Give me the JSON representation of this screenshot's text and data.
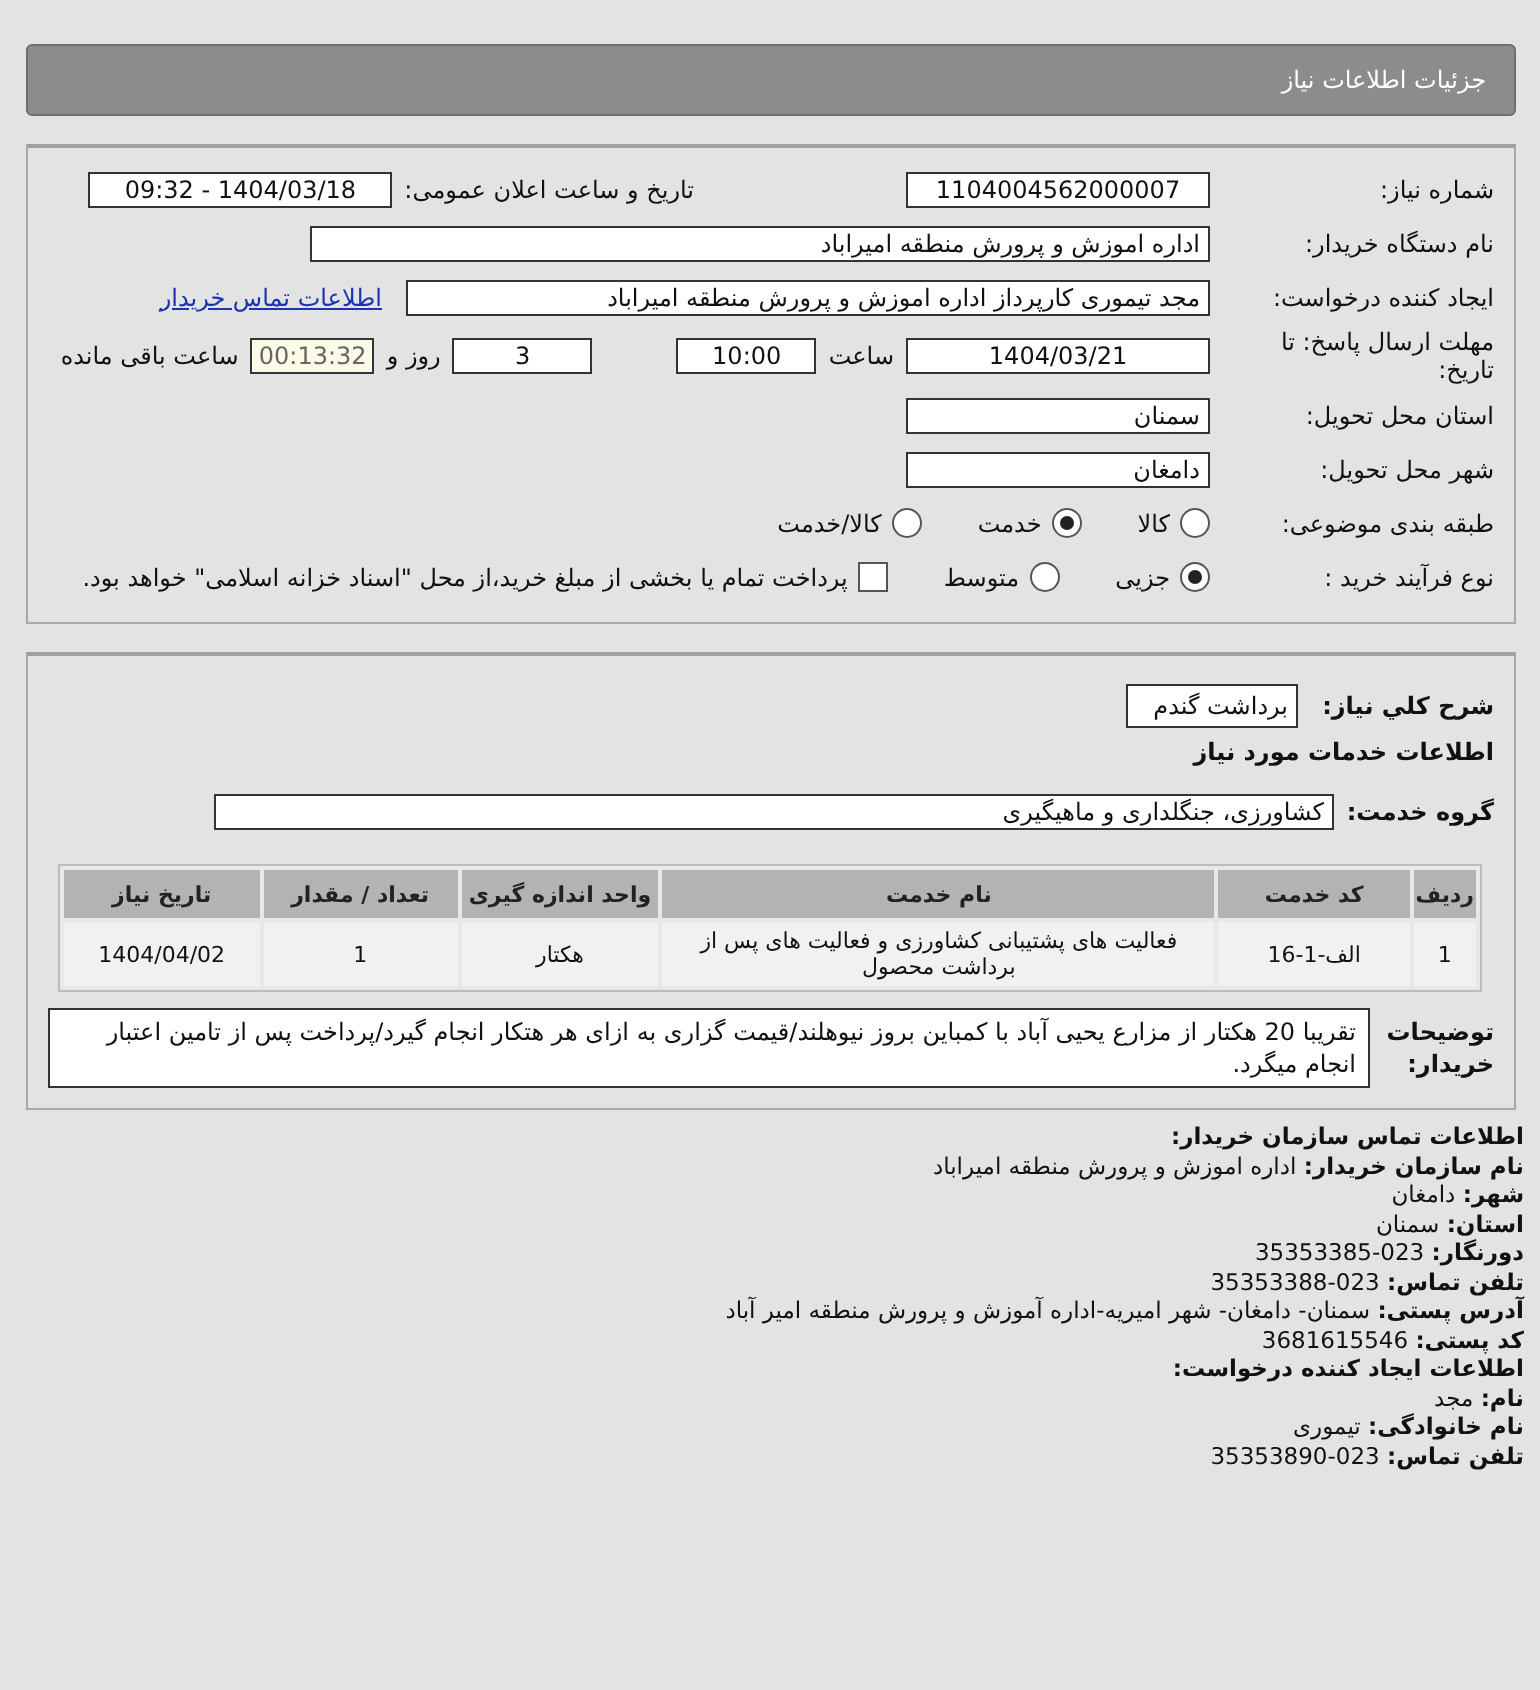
{
  "header": {
    "title": "جزئیات اطلاعات نیاز"
  },
  "details": {
    "need_number": {
      "label": "شماره نیاز:",
      "value": "1104004562000007"
    },
    "announce": {
      "label": "تاریخ و ساعت اعلان عمومی:",
      "value": "1404/03/18 - 09:32"
    },
    "buyer_org": {
      "label": "نام دستگاه خریدار:",
      "value": "اداره اموزش و پرورش منطقه امیراباد"
    },
    "requester": {
      "label": "ایجاد کننده درخواست:",
      "value": "مجد  تیموری کارپرداز اداره اموزش و پرورش منطقه امیراباد",
      "link": "اطلاعات تماس خریدار"
    },
    "deadline": {
      "label": "مهلت ارسال پاسخ: تا تاریخ:",
      "date": "1404/03/21",
      "time_label": "ساعت",
      "time": "10:00",
      "days": "3",
      "days_label": "روز و",
      "remaining": "00:13:32",
      "remaining_label": "ساعت باقی مانده"
    },
    "province": {
      "label": "استان محل تحویل:",
      "value": "سمنان"
    },
    "city": {
      "label": "شهر محل تحویل:",
      "value": "دامغان"
    },
    "category": {
      "label": "طبقه بندی موضوعی:",
      "options": [
        {
          "label": "کالا",
          "selected": false
        },
        {
          "label": "خدمت",
          "selected": true
        },
        {
          "label": "کالا/خدمت",
          "selected": false
        }
      ]
    },
    "process": {
      "label": "نوع فرآیند خرید :",
      "options": [
        {
          "label": "جزیی",
          "selected": true
        },
        {
          "label": "متوسط",
          "selected": false
        }
      ],
      "treasury": {
        "checked": false,
        "label": "پرداخت تمام یا بخشی از مبلغ خرید،از محل \"اسناد خزانه اسلامی\" خواهد بود."
      }
    }
  },
  "need": {
    "summary": {
      "label": "شرح کلي نياز:",
      "value": "برداشت گندم"
    },
    "services_heading": "اطلاعات خدمات مورد نیاز",
    "service_group": {
      "label": "گروه خدمت:",
      "value": "کشاورزی، جنگلداری و ماهیگیری"
    },
    "table": {
      "columns": [
        "ردیف",
        "کد خدمت",
        "نام خدمت",
        "واحد اندازه گیری",
        "تعداد / مقدار",
        "تاریخ نیاز"
      ],
      "rows": [
        [
          "1",
          "الف-1-16",
          "فعالیت های پشتیبانی کشاورزی و فعالیت های پس از برداشت محصول",
          "هکتار",
          "1",
          "1404/04/02"
        ]
      ]
    },
    "description": {
      "label": "توضیحات خریدار:",
      "value": "تقریبا 20 هکتار از مزارع یحیی آباد با کمباین بروز نیوهلند/قیمت گزاری به ازای هر هتکار انجام گیرد/پرداخت پس از تامین اعتبار انجام میگرد."
    }
  },
  "contact": [
    {
      "kind": "title",
      "text": "اطلاعات تماس سازمان خریدار:"
    },
    {
      "kind": "pair",
      "label": "نام سازمان خریدار:",
      "value": "اداره اموزش و پرورش منطقه امیراباد"
    },
    {
      "kind": "pair",
      "label": "شهر:",
      "value": "دامغان"
    },
    {
      "kind": "pair",
      "label": "استان:",
      "value": "سمنان"
    },
    {
      "kind": "pair",
      "label": "دورنگار:",
      "value": "023-35353385"
    },
    {
      "kind": "pair",
      "label": "تلفن تماس:",
      "value": "023-35353388"
    },
    {
      "kind": "pair",
      "label": "آدرس پستی:",
      "value": "سمنان- دامغان- شهر امیریه-اداره آموزش و پرورش منطقه امیر آباد"
    },
    {
      "kind": "pair",
      "label": "کد پستی:",
      "value": "3681615546"
    },
    {
      "kind": "title",
      "text": "اطلاعات ایجاد کننده درخواست:"
    },
    {
      "kind": "pair",
      "label": "نام:",
      "value": "مجد"
    },
    {
      "kind": "pair",
      "label": "نام خانوادگی:",
      "value": "تیموری"
    },
    {
      "kind": "pair",
      "label": "تلفن تماس:",
      "value": "023-35353890"
    }
  ]
}
